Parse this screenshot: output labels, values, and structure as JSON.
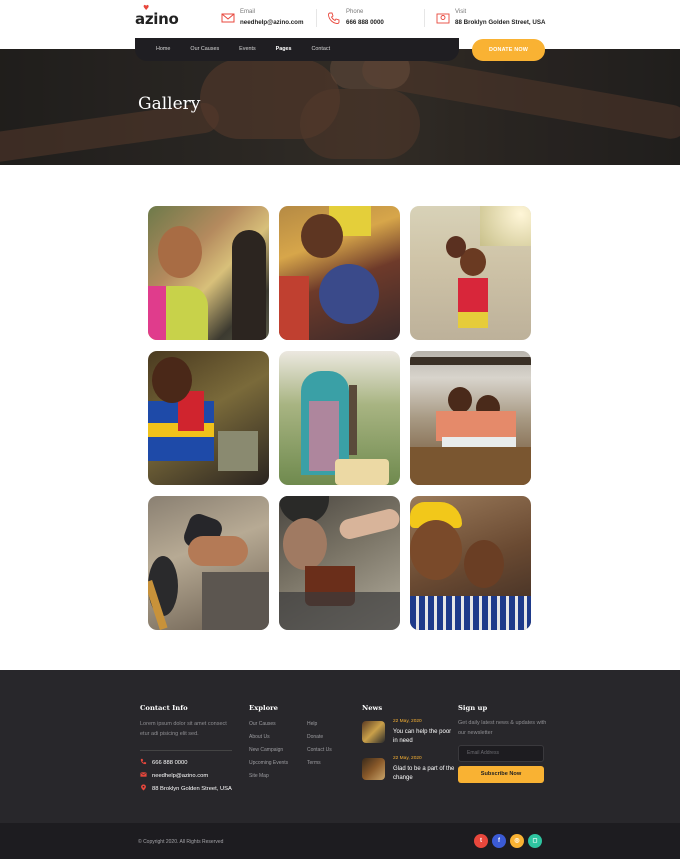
{
  "brand": {
    "name": "azino"
  },
  "header": {
    "email": {
      "label": "Email",
      "value": "needhelp@azino.com"
    },
    "phone": {
      "label": "Phone",
      "value": "666 888 0000"
    },
    "visit": {
      "label": "Visit",
      "value": "88 Broklyn Golden Street, USA"
    }
  },
  "nav": {
    "items": [
      "Home",
      "Our Causes",
      "Events",
      "Pages",
      "Contact"
    ],
    "active": "Pages",
    "donate_label": "DONATE NOW"
  },
  "hero": {
    "title": "Gallery"
  },
  "gallery": {
    "images": [
      "children-portrait-1",
      "mother-and-baby",
      "children-playing",
      "girl-portrait",
      "water-pump",
      "students-reading",
      "coins-in-hand",
      "elder-with-cup",
      "girl-and-boy"
    ]
  },
  "footer": {
    "contact": {
      "heading": "Contact Info",
      "text": "Lorem ipsum dolor sit amet consect etur adi pisicing elit sed.",
      "phone": "666 888 0000",
      "email": "needhelp@azino.com",
      "address": "88 Broklyn Golden Street, USA"
    },
    "explore": {
      "heading": "Explore",
      "col1": [
        "Our Causes",
        "About Us",
        "New Campaign",
        "Upcoming Events",
        "Site Map"
      ],
      "col2": [
        "Help",
        "Donate",
        "Contact Us",
        "Terms"
      ]
    },
    "news": {
      "heading": "News",
      "items": [
        {
          "date": "22 May, 2020",
          "title": "You can help the poor in need"
        },
        {
          "date": "22 May, 2020",
          "title": "Glad to be a part of the change"
        }
      ]
    },
    "signup": {
      "heading": "Sign up",
      "text": "Get daily latest news & updates with our newsletter",
      "placeholder": "Email Address",
      "button": "Subscribe Now"
    },
    "copyright": "© Copyright 2020. All Rights Reserved",
    "social": [
      {
        "name": "twitter",
        "glyph": "t",
        "color": "#e8473c"
      },
      {
        "name": "facebook",
        "glyph": "f",
        "color": "#3b5bd6"
      },
      {
        "name": "dribbble",
        "glyph": "◎",
        "color": "#f9b233"
      },
      {
        "name": "instagram",
        "glyph": "◻",
        "color": "#2ec4a0"
      }
    ]
  },
  "colors": {
    "accent": "#f9b233",
    "red": "#e8473c",
    "dark": "#28272b"
  }
}
